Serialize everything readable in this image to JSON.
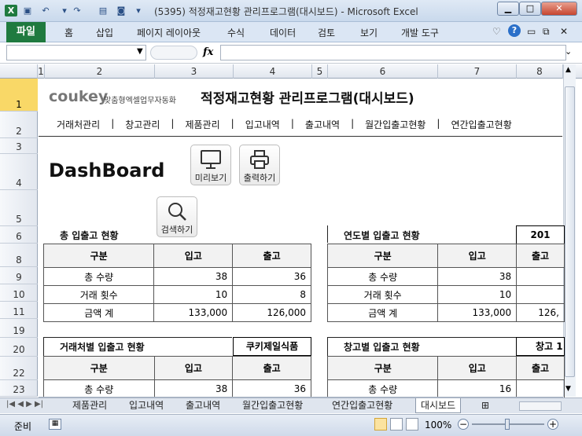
{
  "window": {
    "title": "(5395) 적정재고현황 관리프로그램(대시보드) - Microsoft Excel"
  },
  "ribbon": {
    "file_tab": "파일",
    "tabs": [
      "홈",
      "삽입",
      "페이지 레이아웃",
      "수식",
      "데이터",
      "검토",
      "보기",
      "개발 도구"
    ]
  },
  "formula_bar": {
    "fx_label": "fx",
    "name_box": "",
    "formula": ""
  },
  "columns": [
    "1",
    "2",
    "3",
    "4",
    "5",
    "6",
    "7",
    "8"
  ],
  "rows": [
    "1",
    "2",
    "3",
    "4",
    "5",
    "6",
    "8",
    "9",
    "10",
    "11",
    "19",
    "20",
    "22",
    "23"
  ],
  "header": {
    "brand": "coukey",
    "brand_sub": "맞춤형엑셀업무자동화",
    "program_title": "적정재고현황 관리프로그램(대시보드)"
  },
  "menu": [
    "거래처관리",
    "|",
    "창고관리",
    "|",
    "제품관리",
    "|",
    "입고내역",
    "|",
    "출고내역",
    "|",
    "월간입출고현황",
    "|",
    "연간입출고현황"
  ],
  "dashboard": {
    "title": "DashBoard",
    "preview_label": "미리보기",
    "print_label": "출력하기",
    "search_label": "검색하기"
  },
  "total_section": {
    "title": "총 입출고 현황",
    "headers": [
      "구분",
      "입고",
      "출고"
    ],
    "rows": [
      [
        "총 수량",
        "38",
        "36"
      ],
      [
        "거래 횟수",
        "10",
        "8"
      ],
      [
        "금액 계",
        "133,000",
        "126,000"
      ]
    ]
  },
  "yearly_section": {
    "title": "연도별 입출고 현황",
    "year_box": "201",
    "headers": [
      "구분",
      "입고",
      "출고"
    ],
    "rows": [
      [
        "총 수량",
        "38",
        ""
      ],
      [
        "거래 횟수",
        "10",
        ""
      ],
      [
        "금액 계",
        "133,000",
        "126,"
      ]
    ]
  },
  "partner_section": {
    "title": "거래처별 입출고 현황",
    "partner_box": "쿠키제일식품",
    "headers": [
      "구분",
      "입고",
      "출고"
    ],
    "rows": [
      [
        "총 수량",
        "38",
        "36"
      ]
    ]
  },
  "warehouse_section": {
    "title": "창고별 입출고 현황",
    "warehouse_box": "창고 1",
    "headers": [
      "구분",
      "입고",
      "출고"
    ],
    "rows": [
      [
        "총 수량",
        "16",
        ""
      ]
    ]
  },
  "sheet_tabs": [
    "제품관리",
    "입고내역",
    "출고내역",
    "월간입출고현황",
    "연간입출고현황",
    "대시보드"
  ],
  "status": {
    "ready": "준비",
    "zoom": "100%"
  }
}
